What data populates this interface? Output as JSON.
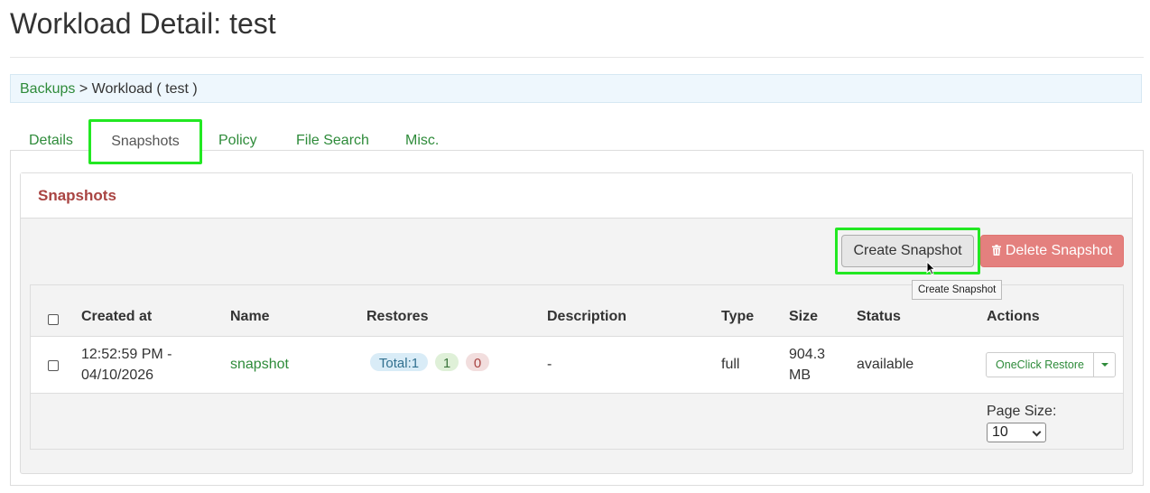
{
  "page": {
    "title": "Workload Detail: test"
  },
  "breadcrumb": {
    "link": "Backups",
    "separator": ">",
    "current": "Workload ( test )"
  },
  "tabs": [
    {
      "label": "Details"
    },
    {
      "label": "Snapshots"
    },
    {
      "label": "Policy"
    },
    {
      "label": "File Search"
    },
    {
      "label": "Misc."
    }
  ],
  "panel": {
    "title": "Snapshots"
  },
  "toolbar": {
    "create_label": "Create Snapshot",
    "delete_label": "Delete Snapshot",
    "tooltip": "Create Snapshot"
  },
  "table": {
    "headers": {
      "created_at": "Created at",
      "name": "Name",
      "restores": "Restores",
      "description": "Description",
      "type": "Type",
      "size": "Size",
      "status": "Status",
      "actions": "Actions"
    },
    "rows": [
      {
        "created_time": "12:52:59 PM -",
        "created_date": "04/10/2026",
        "name": "snapshot",
        "restores_total": "Total:1",
        "restores_success": "1",
        "restores_failed": "0",
        "description": "-",
        "type": "full",
        "size_value": "904.3",
        "size_unit": "MB",
        "status": "available",
        "action_label": "OneClick Restore"
      }
    ]
  },
  "pagination": {
    "label": "Page Size:",
    "value": "10"
  },
  "colors": {
    "link": "#2e8b3a",
    "panel_title": "#a94442",
    "delete_button": "#e4807e",
    "highlight": "#22e822",
    "badge_total_bg": "#d9ecf7",
    "badge_success_bg": "#dff0d8",
    "badge_failed_bg": "#f2dede"
  }
}
